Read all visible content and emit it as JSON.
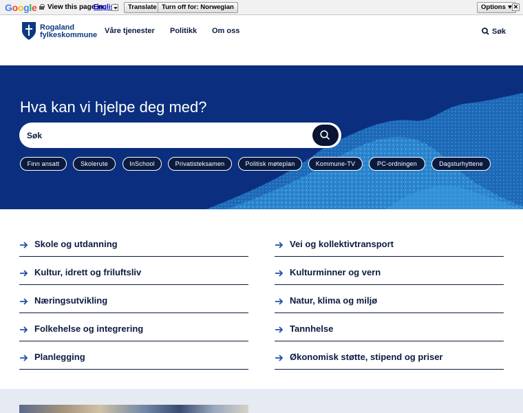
{
  "translate_bar": {
    "logo": "Google",
    "view_text": "View this page in:",
    "language": "English",
    "translate_button": "Translate",
    "turn_off_button": "Turn off for: Norwegian",
    "options_button": "Options",
    "close": "✕"
  },
  "header": {
    "logo_line1": "Rogaland",
    "logo_line2": "fylkeskommune",
    "nav": [
      "Våre tjenester",
      "Politikk",
      "Om oss"
    ],
    "search_label": "Søk"
  },
  "hero": {
    "title": "Hva kan vi hjelpe deg med?",
    "search_placeholder": "Søk",
    "chips": [
      "Finn ansatt",
      "Skolerute",
      "InSchool",
      "Privatisteksamen",
      "Politisk møteplan",
      "Kommune-TV",
      "PC-ordningen",
      "Dagsturhyttene"
    ]
  },
  "topics": {
    "left": [
      "Skole og utdanning",
      "Kultur, idrett og friluftsliv",
      "Næringsutvikling",
      "Folkehelse og integrering",
      "Planlegging"
    ],
    "right": [
      "Vei og kollektivtransport",
      "Kulturminner og vern",
      "Natur, klima og miljø",
      "Tannhelse",
      "Økonomisk støtte, stipend og priser"
    ]
  },
  "colors": {
    "navy": "#0b2f7e",
    "dark": "#0b1b3f",
    "pattern_blue": "#2a8bd6"
  }
}
